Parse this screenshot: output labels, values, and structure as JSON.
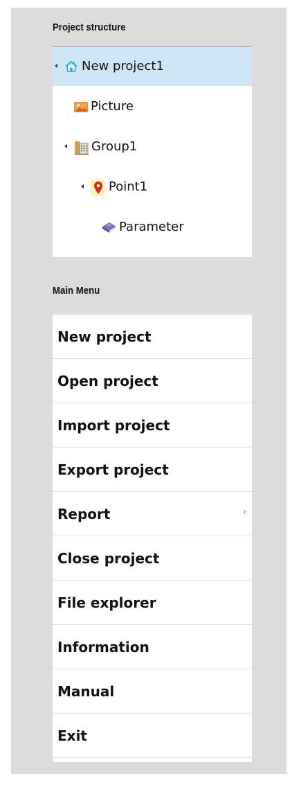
{
  "colors": {
    "panel_bg": "#dcdcdc",
    "selected_row": "#cfe6f7",
    "home_icon": "#2aa8e0",
    "point_icon": "#e02424",
    "picture_icon": "#f08a24"
  },
  "structure": {
    "title": "Project structure",
    "nodes": [
      {
        "label": "New project1",
        "icon": "home-icon",
        "expanded": true,
        "selected": true
      },
      {
        "label": "Picture",
        "icon": "picture-icon"
      },
      {
        "label": "Group1",
        "icon": "building-icon",
        "expanded": true
      },
      {
        "label": "Point1",
        "icon": "map-pin-icon",
        "expanded": true
      },
      {
        "label": "Parameter",
        "icon": "book-icon"
      }
    ]
  },
  "menu": {
    "title": "Main Menu",
    "items": [
      {
        "label": "New project"
      },
      {
        "label": "Open project"
      },
      {
        "label": "Import project"
      },
      {
        "label": "Export project"
      },
      {
        "label": "Report",
        "submenu": true,
        "chevron": "›"
      },
      {
        "label": "Close project"
      },
      {
        "label": "File explorer"
      },
      {
        "label": "Information"
      },
      {
        "label": "Manual"
      },
      {
        "label": "Exit"
      }
    ]
  }
}
